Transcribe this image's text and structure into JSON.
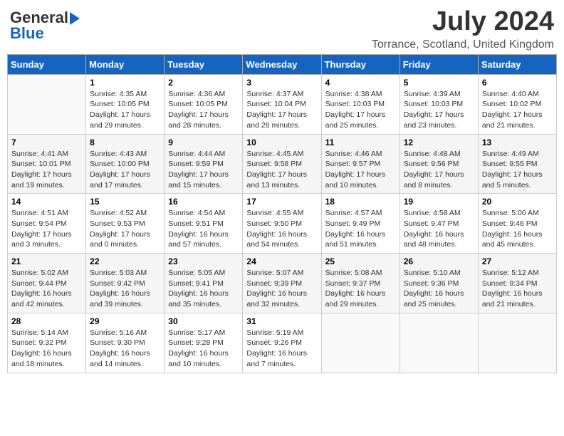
{
  "header": {
    "logo_general": "General",
    "logo_blue": "Blue",
    "month": "July 2024",
    "location": "Torrance, Scotland, United Kingdom"
  },
  "days_of_week": [
    "Sunday",
    "Monday",
    "Tuesday",
    "Wednesday",
    "Thursday",
    "Friday",
    "Saturday"
  ],
  "weeks": [
    [
      {
        "day": "",
        "info": ""
      },
      {
        "day": "1",
        "info": "Sunrise: 4:35 AM\nSunset: 10:05 PM\nDaylight: 17 hours\nand 29 minutes."
      },
      {
        "day": "2",
        "info": "Sunrise: 4:36 AM\nSunset: 10:05 PM\nDaylight: 17 hours\nand 28 minutes."
      },
      {
        "day": "3",
        "info": "Sunrise: 4:37 AM\nSunset: 10:04 PM\nDaylight: 17 hours\nand 26 minutes."
      },
      {
        "day": "4",
        "info": "Sunrise: 4:38 AM\nSunset: 10:03 PM\nDaylight: 17 hours\nand 25 minutes."
      },
      {
        "day": "5",
        "info": "Sunrise: 4:39 AM\nSunset: 10:03 PM\nDaylight: 17 hours\nand 23 minutes."
      },
      {
        "day": "6",
        "info": "Sunrise: 4:40 AM\nSunset: 10:02 PM\nDaylight: 17 hours\nand 21 minutes."
      }
    ],
    [
      {
        "day": "7",
        "info": "Sunrise: 4:41 AM\nSunset: 10:01 PM\nDaylight: 17 hours\nand 19 minutes."
      },
      {
        "day": "8",
        "info": "Sunrise: 4:43 AM\nSunset: 10:00 PM\nDaylight: 17 hours\nand 17 minutes."
      },
      {
        "day": "9",
        "info": "Sunrise: 4:44 AM\nSunset: 9:59 PM\nDaylight: 17 hours\nand 15 minutes."
      },
      {
        "day": "10",
        "info": "Sunrise: 4:45 AM\nSunset: 9:58 PM\nDaylight: 17 hours\nand 13 minutes."
      },
      {
        "day": "11",
        "info": "Sunrise: 4:46 AM\nSunset: 9:57 PM\nDaylight: 17 hours\nand 10 minutes."
      },
      {
        "day": "12",
        "info": "Sunrise: 4:48 AM\nSunset: 9:56 PM\nDaylight: 17 hours\nand 8 minutes."
      },
      {
        "day": "13",
        "info": "Sunrise: 4:49 AM\nSunset: 9:55 PM\nDaylight: 17 hours\nand 5 minutes."
      }
    ],
    [
      {
        "day": "14",
        "info": "Sunrise: 4:51 AM\nSunset: 9:54 PM\nDaylight: 17 hours\nand 3 minutes."
      },
      {
        "day": "15",
        "info": "Sunrise: 4:52 AM\nSunset: 9:53 PM\nDaylight: 17 hours\nand 0 minutes."
      },
      {
        "day": "16",
        "info": "Sunrise: 4:54 AM\nSunset: 9:51 PM\nDaylight: 16 hours\nand 57 minutes."
      },
      {
        "day": "17",
        "info": "Sunrise: 4:55 AM\nSunset: 9:50 PM\nDaylight: 16 hours\nand 54 minutes."
      },
      {
        "day": "18",
        "info": "Sunrise: 4:57 AM\nSunset: 9:49 PM\nDaylight: 16 hours\nand 51 minutes."
      },
      {
        "day": "19",
        "info": "Sunrise: 4:58 AM\nSunset: 9:47 PM\nDaylight: 16 hours\nand 48 minutes."
      },
      {
        "day": "20",
        "info": "Sunrise: 5:00 AM\nSunset: 9:46 PM\nDaylight: 16 hours\nand 45 minutes."
      }
    ],
    [
      {
        "day": "21",
        "info": "Sunrise: 5:02 AM\nSunset: 9:44 PM\nDaylight: 16 hours\nand 42 minutes."
      },
      {
        "day": "22",
        "info": "Sunrise: 5:03 AM\nSunset: 9:42 PM\nDaylight: 16 hours\nand 39 minutes."
      },
      {
        "day": "23",
        "info": "Sunrise: 5:05 AM\nSunset: 9:41 PM\nDaylight: 16 hours\nand 35 minutes."
      },
      {
        "day": "24",
        "info": "Sunrise: 5:07 AM\nSunset: 9:39 PM\nDaylight: 16 hours\nand 32 minutes."
      },
      {
        "day": "25",
        "info": "Sunrise: 5:08 AM\nSunset: 9:37 PM\nDaylight: 16 hours\nand 29 minutes."
      },
      {
        "day": "26",
        "info": "Sunrise: 5:10 AM\nSunset: 9:36 PM\nDaylight: 16 hours\nand 25 minutes."
      },
      {
        "day": "27",
        "info": "Sunrise: 5:12 AM\nSunset: 9:34 PM\nDaylight: 16 hours\nand 21 minutes."
      }
    ],
    [
      {
        "day": "28",
        "info": "Sunrise: 5:14 AM\nSunset: 9:32 PM\nDaylight: 16 hours\nand 18 minutes."
      },
      {
        "day": "29",
        "info": "Sunrise: 5:16 AM\nSunset: 9:30 PM\nDaylight: 16 hours\nand 14 minutes."
      },
      {
        "day": "30",
        "info": "Sunrise: 5:17 AM\nSunset: 9:28 PM\nDaylight: 16 hours\nand 10 minutes."
      },
      {
        "day": "31",
        "info": "Sunrise: 5:19 AM\nSunset: 9:26 PM\nDaylight: 16 hours\nand 7 minutes."
      },
      {
        "day": "",
        "info": ""
      },
      {
        "day": "",
        "info": ""
      },
      {
        "day": "",
        "info": ""
      }
    ]
  ]
}
